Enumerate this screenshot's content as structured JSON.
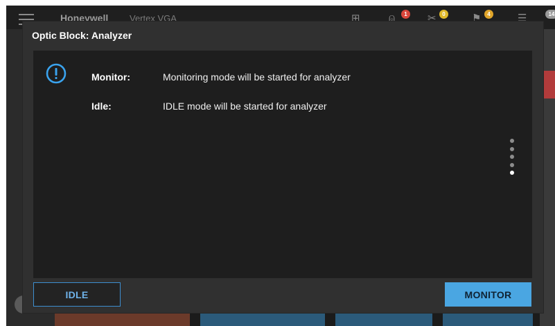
{
  "background_app": {
    "brand": "Honeywell",
    "product": "Vertex VGA",
    "badges": [
      {
        "text": "1",
        "color": "#d9463b"
      },
      {
        "text": "0",
        "color": "#e0b92a"
      },
      {
        "text": "4",
        "color": "#e0a52a"
      },
      {
        "text": "14",
        "color": "#9a9a9a"
      }
    ]
  },
  "dialog": {
    "title": "Optic Block: Analyzer",
    "icon": "info-exclamation-icon",
    "rows": [
      {
        "label": "Monitor:",
        "text": "Monitoring mode will be started for analyzer"
      },
      {
        "label": "Idle:",
        "text": "IDLE mode will be started for analyzer"
      }
    ],
    "pager": {
      "total": 5,
      "active_index": 4
    },
    "buttons": {
      "idle": "IDLE",
      "monitor": "MONITOR"
    }
  },
  "colors": {
    "accent": "#4aa6e2",
    "accent_outline": "#3d8fd1",
    "dialog_bg": "#303030",
    "body_bg": "#1e1e1e"
  }
}
